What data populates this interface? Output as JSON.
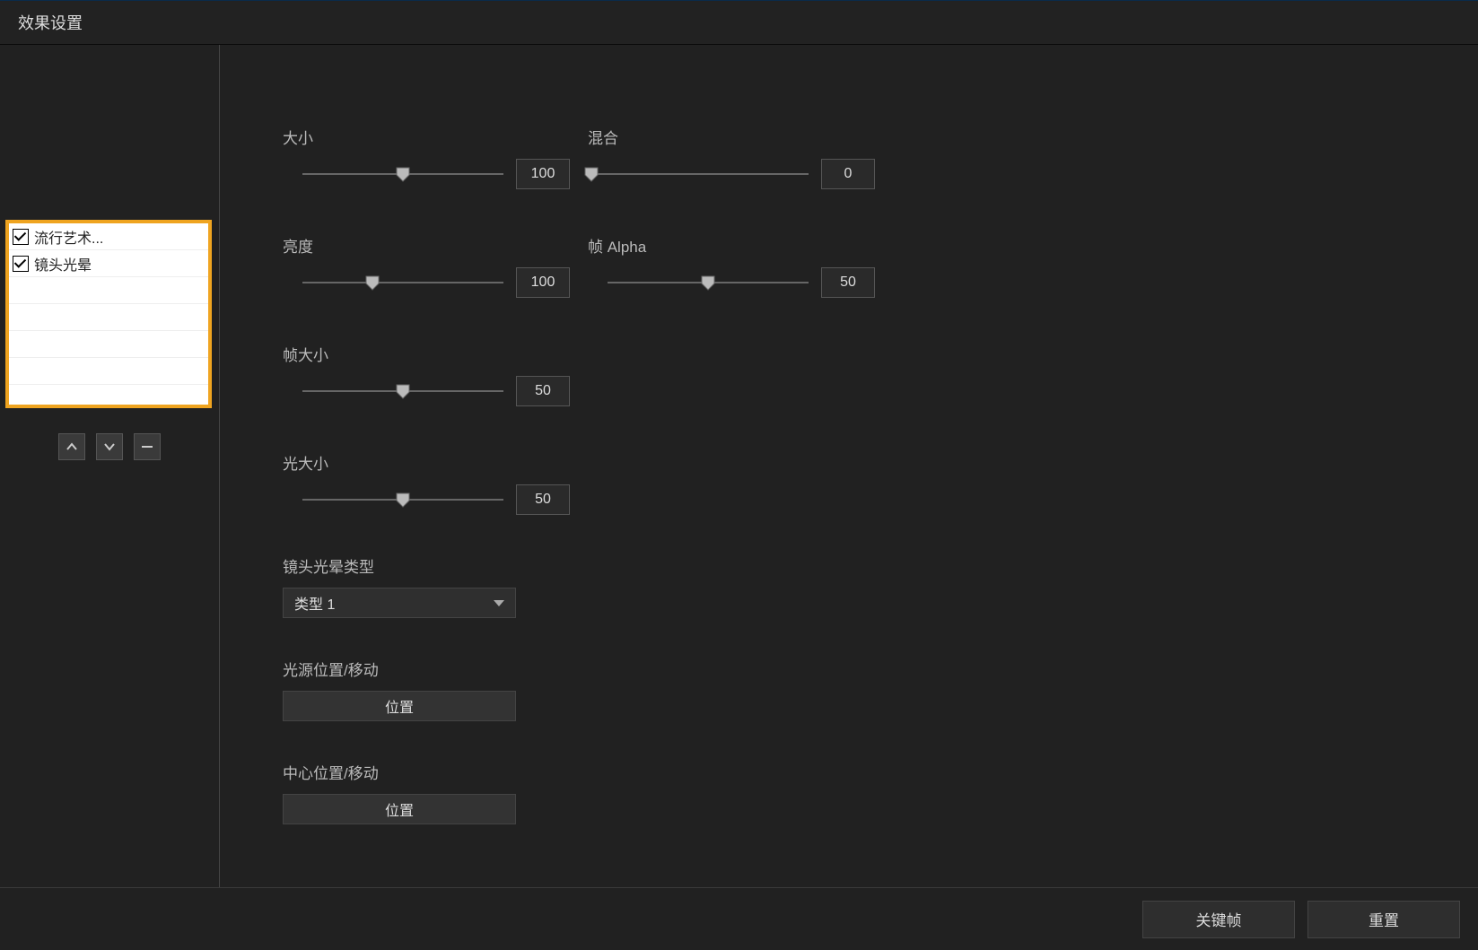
{
  "title": "效果设置",
  "effects": [
    {
      "label": "流行艺术...",
      "checked": true
    },
    {
      "label": "镜头光晕",
      "checked": true
    }
  ],
  "sliders": {
    "size": {
      "label": "大小",
      "value": "100",
      "percent": 50
    },
    "blend": {
      "label": "混合",
      "value": "0",
      "percent": 0
    },
    "brightness": {
      "label": "亮度",
      "value": "100",
      "percent": 35
    },
    "frameAlpha": {
      "label": "帧 Alpha",
      "value": "50",
      "percent": 50
    },
    "frameSize": {
      "label": "帧大小",
      "value": "50",
      "percent": 50
    },
    "lightSize": {
      "label": "光大小",
      "value": "50",
      "percent": 50
    }
  },
  "flareType": {
    "label": "镜头光晕类型",
    "value": "类型 1"
  },
  "lightPos": {
    "label": "光源位置/移动",
    "button": "位置"
  },
  "centerPos": {
    "label": "中心位置/移动",
    "button": "位置"
  },
  "footer": {
    "keyframe": "关键帧",
    "reset": "重置"
  }
}
